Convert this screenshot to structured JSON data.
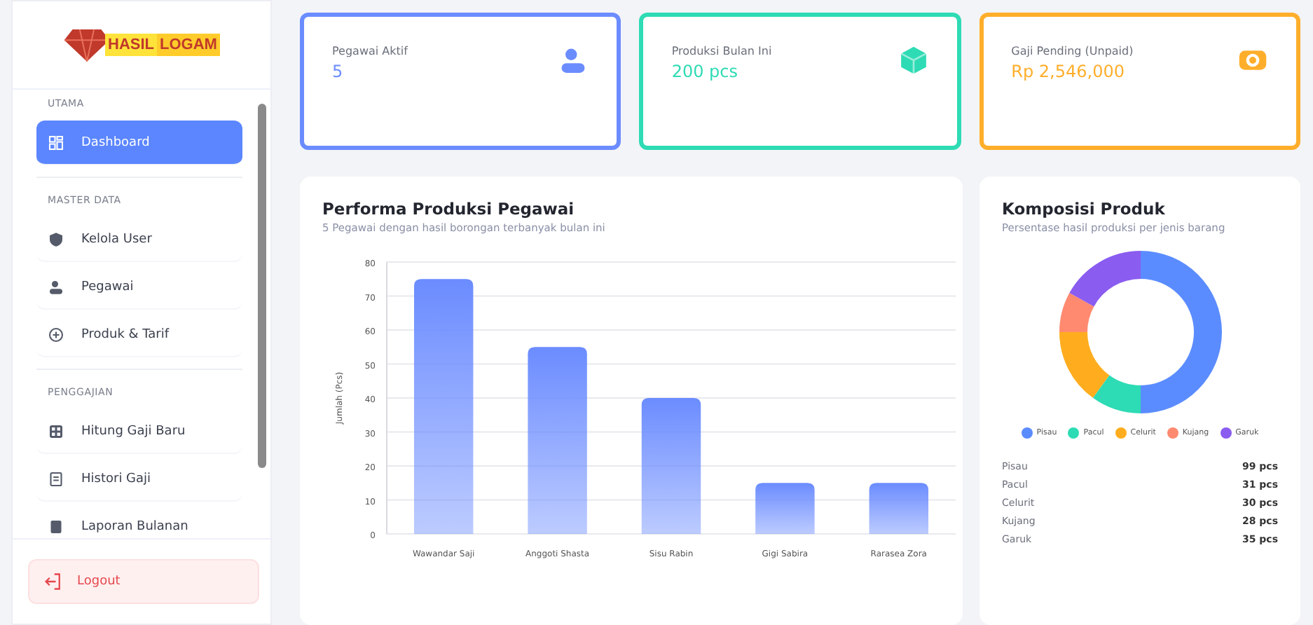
{
  "logo": {
    "words": [
      "HASIL",
      "LOGAM"
    ]
  },
  "sidebar": {
    "sections": [
      {
        "title": "UTAMA",
        "items": [
          {
            "label": "Dashboard",
            "kind": "dashboard",
            "selected": true
          }
        ]
      },
      {
        "title": "MASTER DATA",
        "items": [
          {
            "label": "Kelola User",
            "kind": "shield",
            "selected": false
          },
          {
            "label": "Pegawai",
            "kind": "users",
            "selected": false
          },
          {
            "label": "Produk & Tarif",
            "kind": "tag",
            "selected": false
          }
        ]
      },
      {
        "title": "PENGGAJIAN",
        "items": [
          {
            "label": "Hitung Gaji Baru",
            "kind": "calc",
            "selected": false
          },
          {
            "label": "Histori Gaji",
            "kind": "doc",
            "selected": false
          },
          {
            "label": "Laporan Bulanan",
            "kind": "report",
            "selected": false
          }
        ]
      }
    ],
    "logout": "Logout"
  },
  "stats": [
    {
      "label": "Pegawai Aktif",
      "value": "5",
      "color": "#6b8cff",
      "kind": "users"
    },
    {
      "label": "Produksi Bulan Ini",
      "value": "200 pcs",
      "color": "#2edbb4",
      "kind": "box"
    },
    {
      "label": "Gaji Pending (Unpaid)",
      "value": "Rp 2,546,000",
      "color": "#ffae2b",
      "kind": "money"
    }
  ],
  "performance": {
    "title": "Performa Produksi Pegawai",
    "subtitle": "5 Pegawai dengan hasil borongan terbanyak bulan ini",
    "chart_data": {
      "type": "bar",
      "ylabel": "Jumlah (Pcs)",
      "categories": [
        "Wawandar Saji",
        "Anggoti Shasta",
        "Sisu Rabin",
        "Gigi Sabira",
        "Rarasea Zora"
      ],
      "series": [
        {
          "color": "#6b8cff",
          "values": [
            75,
            55,
            40,
            15,
            15
          ]
        }
      ],
      "ylim": [
        0,
        80
      ],
      "yticks": [
        0,
        10,
        20,
        30,
        40,
        50,
        60,
        70,
        80
      ],
      "grid": true
    }
  },
  "composition": {
    "title": "Komposisi Produk",
    "subtitle": "Persentase hasil produksi per jenis barang",
    "chart_data": {
      "type": "donut",
      "categories": [
        "Pisau",
        "Pacul",
        "Celurit",
        "Kujang",
        "Garuk"
      ],
      "series": [
        {
          "values": [
            50,
            10,
            15,
            8,
            17
          ]
        }
      ],
      "colors": [
        "#5b8cff",
        "#2ddbb4",
        "#ffad1f",
        "#ff8a70",
        "#8a5cf0"
      ]
    },
    "rows": [
      {
        "name": "Pisau",
        "value": "99 pcs"
      },
      {
        "name": "Pacul",
        "value": "31 pcs"
      },
      {
        "name": "Celurit",
        "value": "30 pcs"
      },
      {
        "name": "Kujang",
        "value": "28 pcs"
      },
      {
        "name": "Garuk",
        "value": "35 pcs"
      }
    ]
  }
}
